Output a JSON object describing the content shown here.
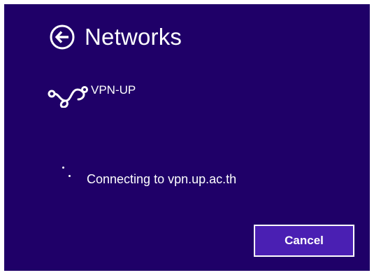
{
  "colors": {
    "panel_background": "#1f0068",
    "button_background": "#4a1fb3",
    "foreground": "#ffffff"
  },
  "header": {
    "back_icon": "arrow-left-circle-icon",
    "title": "Networks"
  },
  "network": {
    "icon": "vpn-link-icon",
    "name": "VPN-UP"
  },
  "status": {
    "icon": "progress-dots-icon",
    "text": "Connecting to vpn.up.ac.th"
  },
  "actions": {
    "cancel_label": "Cancel"
  }
}
